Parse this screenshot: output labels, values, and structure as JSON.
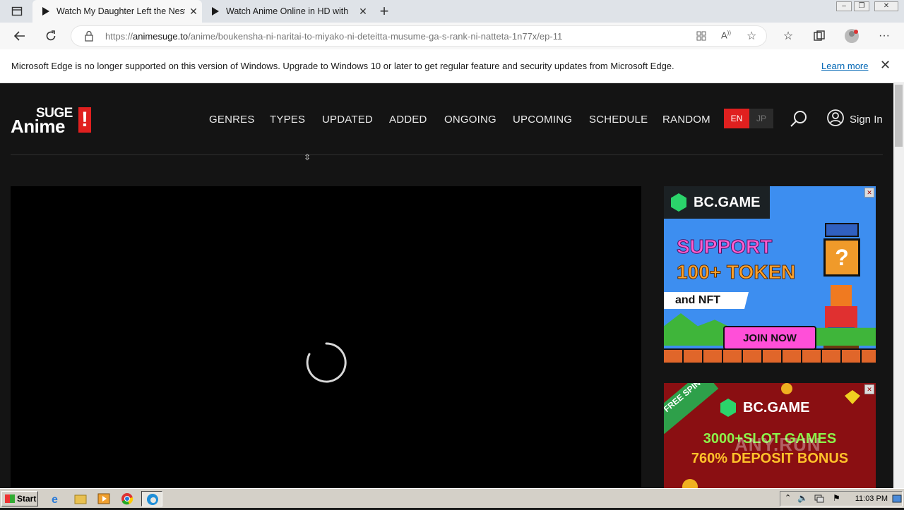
{
  "browser": {
    "tabs": [
      {
        "title": "Watch My Daughter Left the Nest",
        "active": true
      },
      {
        "title": "Watch Anime Online in HD with",
        "active": false
      }
    ],
    "url_scheme": "https://",
    "url_host": "animesuge.to",
    "url_path": "/anime/boukensha-ni-naritai-to-miyako-ni-deteitta-musume-ga-s-rank-ni-natteta-1n77x/ep-11",
    "infobar_text": "Microsoft Edge is no longer supported on this version of Windows. Upgrade to Windows 10 or later to get regular feature and security updates from Microsoft Edge.",
    "infobar_link": "Learn more"
  },
  "site": {
    "logo_top": "SUGE",
    "logo_main": "Anime",
    "logo_bang": "!",
    "nav": [
      "GENRES",
      "TYPES",
      "UPDATED",
      "ADDED",
      "ONGOING",
      "UPCOMING",
      "SCHEDULE",
      "RANDOM"
    ],
    "lang_en": "EN",
    "lang_jp": "JP",
    "signin": "Sign In",
    "accent_color": "#e0201f"
  },
  "ads": {
    "ad1": {
      "brand": "BC.GAME",
      "line1": "SUPPORT",
      "line2": "100+ TOKEN",
      "line3": "and NFT",
      "cta": "JOIN NOW"
    },
    "ad2": {
      "ribbon": "FREE SPIN",
      "brand": "BC.GAME",
      "line1": "3000+SLOT GAMES",
      "line2": "760% DEPOSIT BONUS"
    },
    "watermark": "ANY.RUN"
  },
  "taskbar": {
    "start": "Start",
    "clock": "11:03 PM"
  }
}
